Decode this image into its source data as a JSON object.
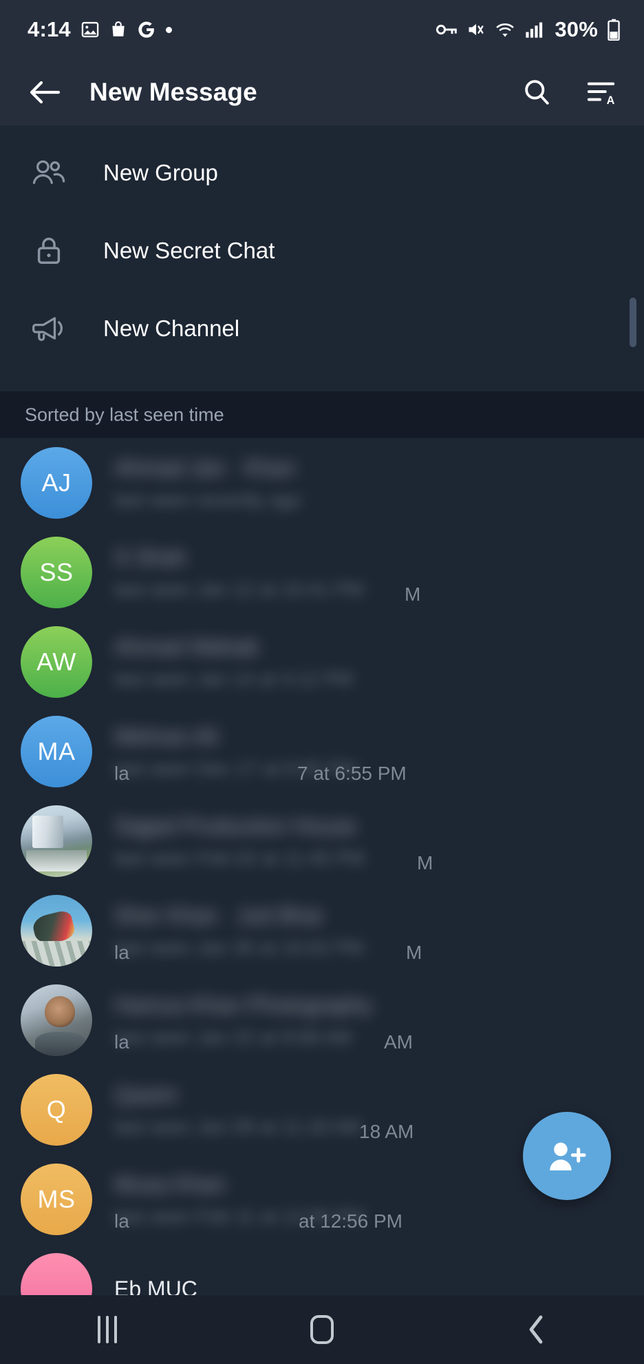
{
  "status_bar": {
    "time": "4:14",
    "battery_percent": "30%",
    "left_icons": [
      "photo-icon",
      "shopping-bag-icon",
      "google-icon",
      "dot-icon"
    ],
    "right_icons": [
      "vpn-key-icon",
      "mute-vibrate-icon",
      "wifi-icon",
      "signal-icon",
      "battery-icon"
    ]
  },
  "app_bar": {
    "title": "New Message",
    "back_label": "Back",
    "search_label": "Search",
    "sort_label": "Sort"
  },
  "actions": [
    {
      "label": "New Group",
      "icon": "people-icon"
    },
    {
      "label": "New Secret Chat",
      "icon": "lock-icon"
    },
    {
      "label": "New Channel",
      "icon": "megaphone-icon"
    }
  ],
  "section_header": "Sorted by last seen time",
  "contacts": [
    {
      "avatar_type": "initials",
      "initials": "AJ",
      "color_start": "#5CA9E8",
      "color_end": "#3C8FD8",
      "name": "Ahmad",
      "status": "",
      "name_blurred": true,
      "status_blurred": true,
      "status_head": "",
      "status_tail": ""
    },
    {
      "avatar_type": "initials",
      "initials": "SS",
      "color_start": "#8CD05A",
      "color_end": "#4CB049",
      "name": "",
      "status": "",
      "name_blurred": true,
      "status_blurred": true,
      "status_head": "",
      "status_tail": "M"
    },
    {
      "avatar_type": "initials",
      "initials": "AW",
      "color_start": "#8CD05A",
      "color_end": "#4CB049",
      "name": "",
      "status": "",
      "name_blurred": true,
      "status_blurred": true,
      "status_head": "",
      "status_tail": ""
    },
    {
      "avatar_type": "initials",
      "initials": "MA",
      "color_start": "#5CA9E8",
      "color_end": "#3C8FD8",
      "name": "",
      "status": "",
      "name_blurred": true,
      "status_blurred": true,
      "status_head": "la",
      "status_tail": "7 at 6:55 PM"
    },
    {
      "avatar_type": "photo",
      "photo": "building-photo",
      "initials": "",
      "name": "",
      "status": "",
      "name_blurred": true,
      "status_blurred": true,
      "status_head": "",
      "status_tail": "M"
    },
    {
      "avatar_type": "photo",
      "photo": "skydiving-photo",
      "initials": "",
      "name": "",
      "status": "",
      "name_blurred": true,
      "status_blurred": true,
      "status_head": "la",
      "status_tail": "M"
    },
    {
      "avatar_type": "photo",
      "photo": "portrait-photo",
      "initials": "",
      "name": "",
      "status": "",
      "name_blurred": true,
      "status_blurred": true,
      "status_head": "la",
      "status_tail": "AM"
    },
    {
      "avatar_type": "initials",
      "initials": "Q",
      "color_start": "#F0BC62",
      "color_end": "#E8A94A",
      "name": "",
      "status": "",
      "name_blurred": true,
      "status_blurred": true,
      "status_head": "",
      "status_tail": "18 AM"
    },
    {
      "avatar_type": "initials",
      "initials": "MS",
      "color_start": "#F0BC62",
      "color_end": "#E8A94A",
      "name": "",
      "status": "",
      "name_blurred": true,
      "status_blurred": true,
      "status_head": "la",
      "status_tail": "at 12:56 PM"
    },
    {
      "avatar_type": "initials",
      "initials": "",
      "color_start": "#F princess",
      "color_end": "#F27BA0",
      "name": "Eb          MUC",
      "status": "",
      "name_blurred": false,
      "status_blurred": true,
      "status_head": "",
      "status_tail": ""
    }
  ],
  "fab": {
    "label": "New Contact",
    "icon": "add-person-icon",
    "color": "#5FA8DD"
  },
  "nav_bar": {
    "recents_label": "Recents",
    "home_label": "Home",
    "back_label": "Back"
  },
  "colors": {
    "background": "#1d2633",
    "appbar": "#262e3c",
    "section_band": "#151b26",
    "accent": "#5FA8DD",
    "text_primary": "#ffffff",
    "text_secondary": "#8c96a5"
  }
}
